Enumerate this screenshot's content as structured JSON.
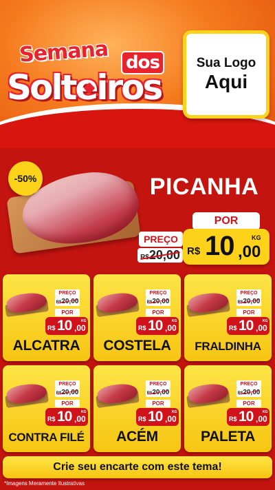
{
  "header": {
    "title_line1": "Semana",
    "title_line2": "dos",
    "title_line3": "Solteiros",
    "logo_line1": "Sua Logo",
    "logo_line2": "Aqui"
  },
  "featured": {
    "discount_badge": "-50%",
    "name": "PICANHA",
    "por_label": "POR",
    "preco_label": "PREÇO",
    "old_price_currency": "R$",
    "old_price": "20,00",
    "new_price_currency": "R$",
    "new_price_int": "10",
    "new_price_dec": ",00",
    "unit": "KG"
  },
  "products": [
    {
      "name": "ALCATRA",
      "preco_label": "PREÇO",
      "old_currency": "R$",
      "old_price": "20,00",
      "por_label": "POR",
      "currency": "R$",
      "price_int": "10",
      "price_dec": ",00",
      "unit": "KG"
    },
    {
      "name": "COSTELA",
      "preco_label": "PREÇO",
      "old_currency": "R$",
      "old_price": "20,00",
      "por_label": "POR",
      "currency": "R$",
      "price_int": "10",
      "price_dec": ",00",
      "unit": "KG"
    },
    {
      "name": "FRALDINHA",
      "preco_label": "PREÇO",
      "old_currency": "R$",
      "old_price": "20,00",
      "por_label": "POR",
      "currency": "R$",
      "price_int": "10",
      "price_dec": ",00",
      "unit": "KG"
    },
    {
      "name": "CONTRA FILÉ",
      "preco_label": "PREÇO",
      "old_currency": "R$",
      "old_price": "20,00",
      "por_label": "POR",
      "currency": "R$",
      "price_int": "10",
      "price_dec": ",00",
      "unit": "KG"
    },
    {
      "name": "ACÉM",
      "preco_label": "PREÇO",
      "old_currency": "R$",
      "old_price": "20,00",
      "por_label": "POR",
      "currency": "R$",
      "price_int": "10",
      "price_dec": ",00",
      "unit": "KG"
    },
    {
      "name": "PALETA",
      "preco_label": "PREÇO",
      "old_currency": "R$",
      "old_price": "20,00",
      "por_label": "POR",
      "currency": "R$",
      "price_int": "10",
      "price_dec": ",00",
      "unit": "KG"
    }
  ],
  "footer": {
    "cta": "Crie seu encarte com este tema!",
    "disclaimer": "*Imagens Meramente Ilustrativas"
  },
  "colors": {
    "brand_red": "#d0121a",
    "accent_yellow": "#fcd21b",
    "header_orange": "#f57a1e"
  }
}
